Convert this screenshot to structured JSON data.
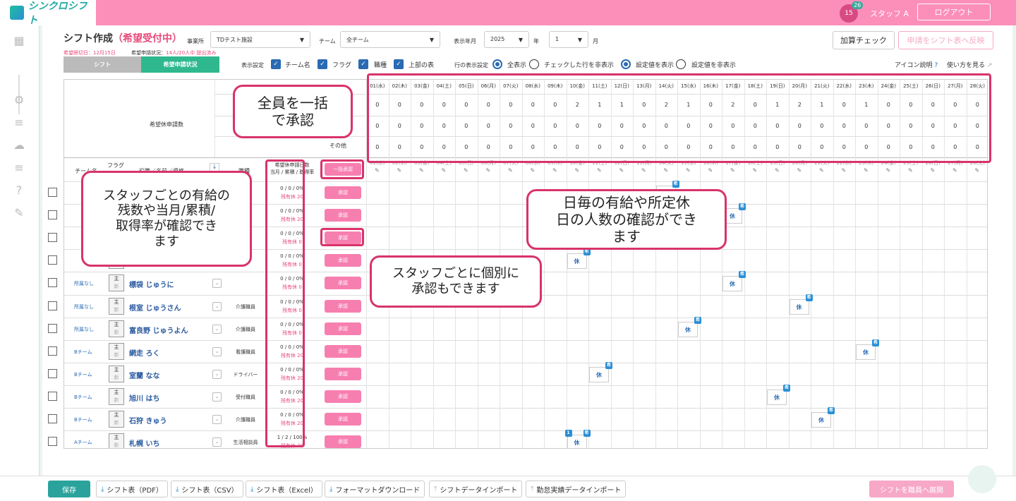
{
  "header": {
    "app_name": "シンクロシフト",
    "cal_day": "15",
    "cal_badge": "26",
    "staff": "スタッフ A",
    "logout": "ログアウト"
  },
  "page": {
    "title": "シフト作成",
    "status": "（希望受付中）",
    "deadline": "希望締切日：12月15日",
    "apply_label": "希望申請状況：",
    "apply_value": "14人/20人中 提出済み"
  },
  "filters": {
    "office_label": "事業所",
    "office": "TDテスト施設",
    "team_label": "チーム",
    "team": "全チーム",
    "year_label": "表示年月",
    "year": "2025",
    "year_unit": "年",
    "month": "1",
    "month_unit": "月"
  },
  "buttons": {
    "check": "加算チェック",
    "reflect": "申請をシフト表へ反映"
  },
  "tabs": {
    "shift": "シフト",
    "request": "希望申請状況"
  },
  "display": {
    "label": "表示設定",
    "opts": [
      "チーム名",
      "フラグ",
      "職種",
      "上部の表"
    ],
    "row_label": "行の表示設定",
    "row_opts": [
      "全表示",
      "チェックした行を非表示",
      "設定値を表示",
      "設定値を非表示"
    ],
    "icon_help": "アイコン説明",
    "howto": "使い方を見る"
  },
  "summary": {
    "title": "希望休申請数",
    "row3": "その他",
    "rows": [
      [
        "0",
        "0",
        "0",
        "0",
        "0",
        "0",
        "0",
        "0",
        "0",
        "2",
        "1",
        "1",
        "0",
        "2",
        "1",
        "0",
        "2",
        "0",
        "1",
        "2",
        "1",
        "0",
        "1",
        "0",
        "0",
        "0",
        "0",
        "0"
      ],
      [
        "0",
        "0",
        "0",
        "0",
        "0",
        "0",
        "0",
        "0",
        "0",
        "0",
        "0",
        "0",
        "0",
        "0",
        "0",
        "0",
        "0",
        "0",
        "0",
        "0",
        "0",
        "0",
        "0",
        "0",
        "0",
        "0",
        "0",
        "0"
      ],
      [
        "0",
        "0",
        "0",
        "0",
        "0",
        "0",
        "0",
        "0",
        "0",
        "0",
        "0",
        "0",
        "0",
        "0",
        "0",
        "0",
        "0",
        "0",
        "0",
        "0",
        "0",
        "0",
        "0",
        "0",
        "0",
        "0",
        "0",
        "0"
      ]
    ]
  },
  "days": [
    "01(水)",
    "02(木)",
    "03(金)",
    "04(土)",
    "05(日)",
    "06(月)",
    "07(火)",
    "08(水)",
    "09(木)",
    "10(金)",
    "11(土)",
    "12(日)",
    "13(月)",
    "14(火)",
    "15(水)",
    "16(木)",
    "17(金)",
    "18(土)",
    "19(日)",
    "20(月)",
    "21(火)",
    "22(水)",
    "23(木)",
    "24(金)",
    "25(土)",
    "26(日)",
    "27(月)",
    "28(火)"
  ],
  "columns": {
    "team": "チーム名",
    "flag": "フラグ",
    "name": "役職／名前／資格",
    "job": "職種",
    "leave1": "希望休申請日数",
    "leave2": "当月 / 累積 / 取得率",
    "bulk": "一括承認"
  },
  "approve": "承認",
  "flag_main": "主",
  "flag_new": "新",
  "rest_label": "残有休",
  "kyu": "休",
  "ki": "希",
  "one": "1",
  "staff": [
    {
      "team": "",
      "name": "",
      "job": "",
      "ratio": "0 / 0 / 0%",
      "rest": "20"
    },
    {
      "team": "",
      "name": "",
      "job": "",
      "ratio": "0 / 0 / 0%",
      "rest": "20"
    },
    {
      "team": "",
      "name": "",
      "job": "",
      "ratio": "0 / 0 / 0%",
      "rest": "0"
    },
    {
      "team": "",
      "name": "",
      "job": "",
      "ratio": "0 / 0 / 0%",
      "rest": "0"
    },
    {
      "team": "所属なし",
      "name": "標袋 じゅうに",
      "job": "",
      "ratio": "0 / 0 / 0%",
      "rest": "0"
    },
    {
      "team": "所属なし",
      "name": "根室 じゅうさん",
      "job": "介護職員",
      "ratio": "0 / 0 / 0%",
      "rest": "0"
    },
    {
      "team": "所属なし",
      "name": "富良野 じゅうよん",
      "job": "介護職員",
      "ratio": "0 / 0 / 0%",
      "rest": "0"
    },
    {
      "team": "Bチーム",
      "name": "網走 ろく",
      "job": "看護職員",
      "ratio": "0 / 0 / 0%",
      "rest": "20"
    },
    {
      "team": "Bチーム",
      "name": "室蘭 なな",
      "job": "ドライバー",
      "ratio": "0 / 0 / 0%",
      "rest": "20"
    },
    {
      "team": "Bチーム",
      "name": "旭川 はち",
      "job": "受付職員",
      "ratio": "0 / 0 / 0%",
      "rest": "20"
    },
    {
      "team": "Bチーム",
      "name": "石狩 きゅう",
      "job": "介護職員",
      "ratio": "0 / 0 / 0%",
      "rest": "20"
    },
    {
      "team": "Aチーム",
      "name": "札幌 いち",
      "job": "生活相談員",
      "ratio": "1 / 2 / 100%",
      "rest": "20"
    }
  ],
  "callouts": {
    "bulk": "全員を一括\nで承認",
    "staff": "スタッフごとの有給の\n残数や当月/累積/\n取得率が確認でき\nます",
    "daily": "日毎の有給や所定休\n日の人数の確認ができ\nます",
    "individual": "スタッフごとに個別に\n承認もできます"
  },
  "bottom": {
    "save": "保存",
    "b1": "シフト表（PDF）",
    "b2": "シフト表（CSV）",
    "b3": "シフト表（Excel）",
    "b4": "フォーマットダウンロード",
    "b5": "シフトデータインポート",
    "b6": "勤怠実績データインポート",
    "deploy": "シフトを職員へ展開"
  }
}
